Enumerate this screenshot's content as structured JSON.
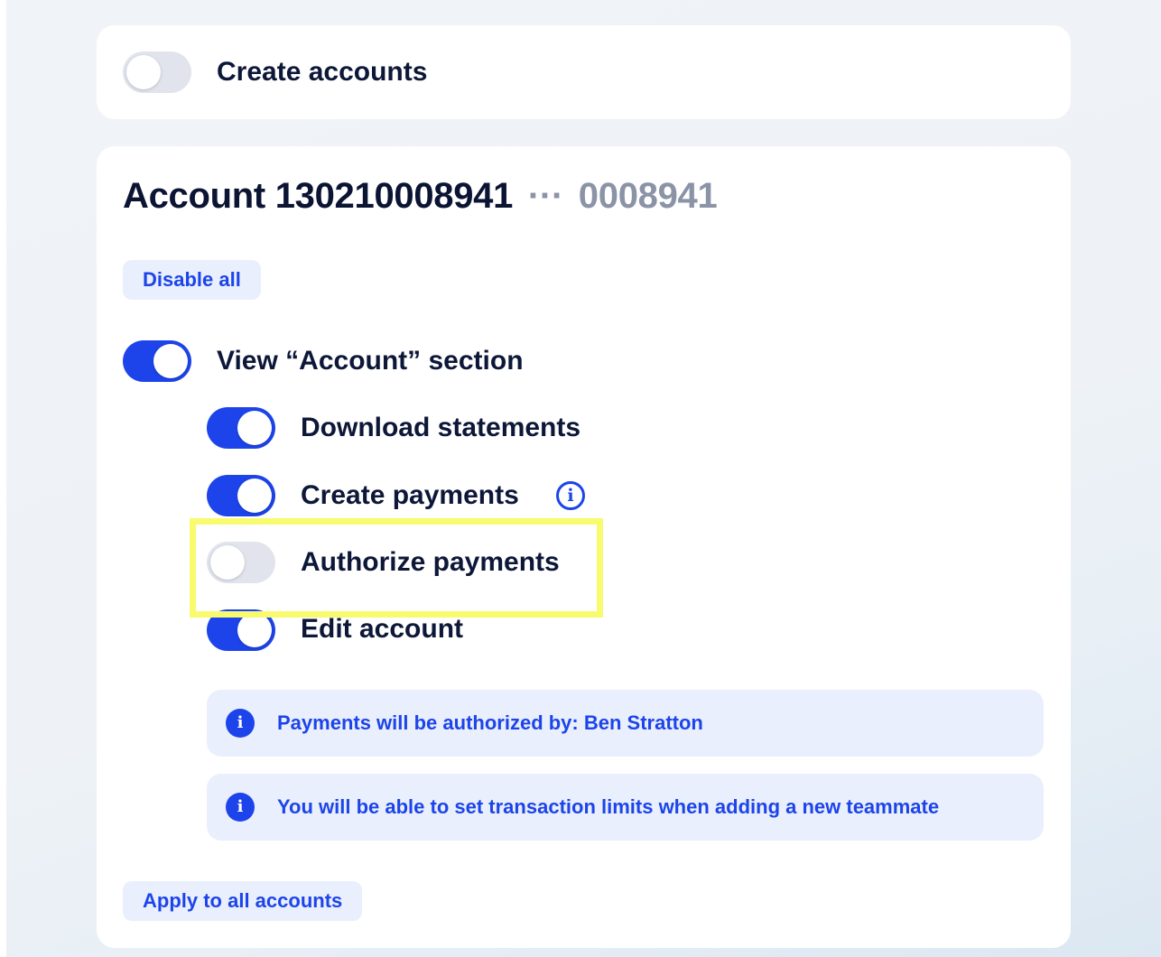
{
  "create_accounts": {
    "label": "Create accounts",
    "enabled": false
  },
  "account": {
    "title": "Account 130210008941",
    "separator": "···",
    "masked_number": "0008941"
  },
  "disable_all_label": "Disable all",
  "permissions": {
    "view_account": {
      "label": "View “Account” section",
      "enabled": true
    },
    "download_statements": {
      "label": "Download statements",
      "enabled": true
    },
    "create_payments": {
      "label": "Create payments",
      "enabled": true,
      "info_icon": "i"
    },
    "authorize_payments": {
      "label": "Authorize payments",
      "enabled": false
    },
    "edit_account": {
      "label": "Edit account",
      "enabled": true
    }
  },
  "notices": [
    {
      "icon": "i",
      "text": "Payments will be authorized by: Ben Stratton"
    },
    {
      "icon": "i",
      "text": "You will be able to set transaction limits when adding a new teammate"
    }
  ],
  "apply_all_label": "Apply to all accounts",
  "colors": {
    "accent": "#1d44ea",
    "toggle_off": "#e1e4ec",
    "chip_bg": "#e9effc",
    "highlight": "#f9fb6e"
  }
}
